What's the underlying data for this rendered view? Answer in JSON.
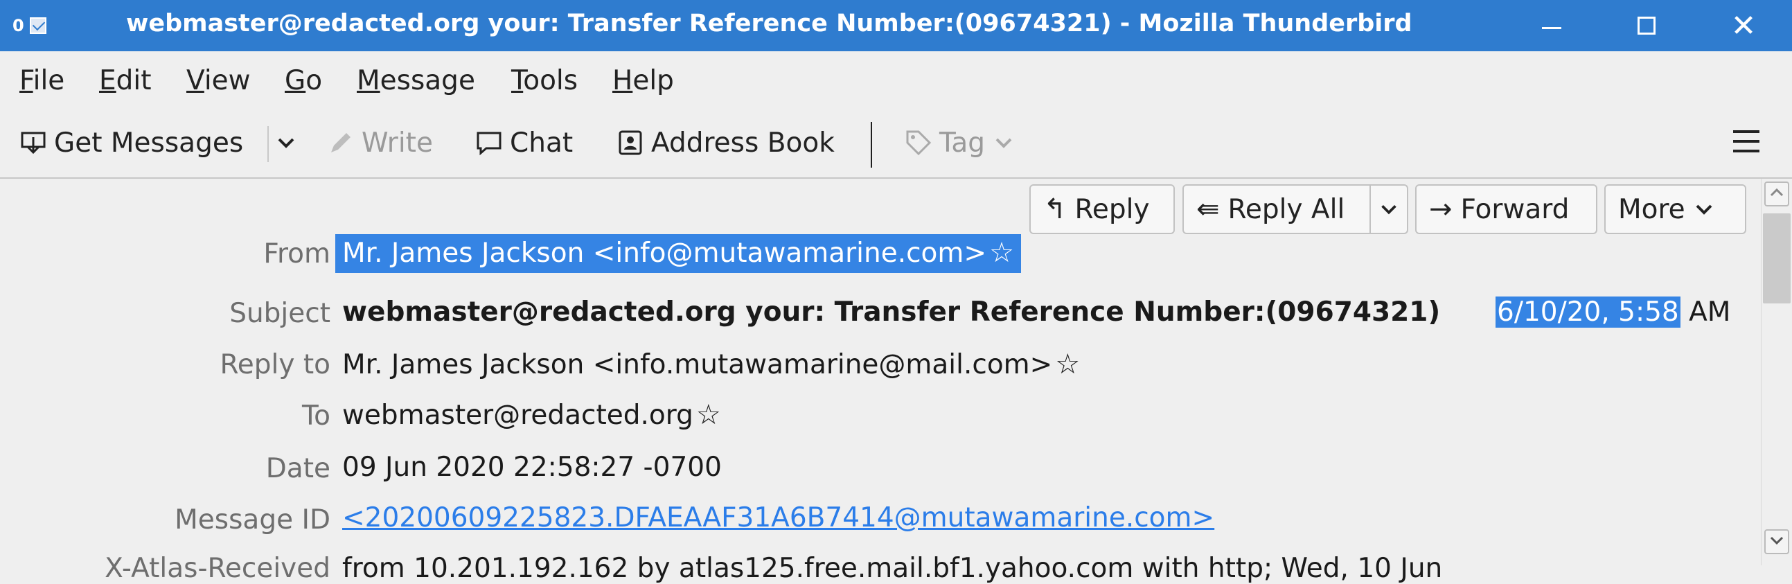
{
  "window": {
    "title": "webmaster@redacted.org your: Transfer Reference Number:(09674321) - Mozilla Thunderbird",
    "app_badge": "0",
    "controls": [
      "minimize",
      "maximize",
      "close"
    ],
    "close_glyph": "✕"
  },
  "menu": [
    {
      "u": "F",
      "rest": "ile"
    },
    {
      "u": "E",
      "rest": "dit"
    },
    {
      "u": "V",
      "rest": "iew"
    },
    {
      "u": "G",
      "rest": "o"
    },
    {
      "u": "M",
      "rest": "essage"
    },
    {
      "u": "T",
      "rest": "ools"
    },
    {
      "u": "H",
      "rest": "elp"
    }
  ],
  "toolbar": {
    "get_messages": "Get Messages",
    "write": "Write",
    "chat": "Chat",
    "address_book": "Address Book",
    "tag": "Tag"
  },
  "header_buttons": {
    "reply": "Reply",
    "reply_all": "Reply All",
    "forward": "Forward",
    "more": "More"
  },
  "headers": {
    "from_label": "From",
    "from_value": "Mr. James Jackson <info@mutawamarine.com>",
    "subject_label": "Subject",
    "subject_value": "webmaster@redacted.org your: Transfer Reference Number:(09674321)",
    "date_short_selected": "6/10/20, 5:58",
    "date_short_rest": " AM",
    "reply_to_label": "Reply to",
    "reply_to_value": "Mr. James Jackson <info.mutawamarine@mail.com>",
    "to_label": "To",
    "to_value": "webmaster@redacted.org",
    "date_label": "Date",
    "date_value": "09 Jun 2020 22:58:27 -0700",
    "message_id_label": "Message ID",
    "message_id_value": "<20200609225823.DFAEAAF31A6B7414@mutawamarine.com>",
    "x_atlas_label": "X-Atlas-Received",
    "x_atlas_value": "from 10.201.192.162 by atlas125.free.mail.bf1.yahoo.com with http; Wed, 10 Jun"
  },
  "icons": {
    "star": "☆",
    "reply": "↰",
    "reply_all": "⇚",
    "forward": "→",
    "chevron": "⌄"
  },
  "colors": {
    "titlebar": "#2f7ccf",
    "selection": "#3584e4",
    "link": "#2b7de9"
  }
}
